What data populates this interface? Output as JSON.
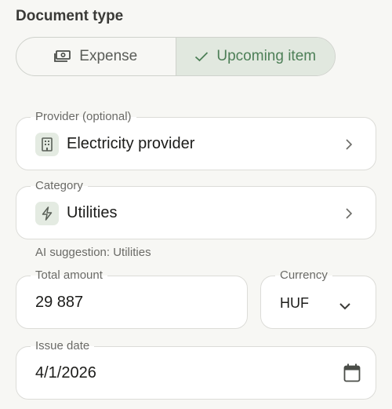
{
  "document_type": {
    "title": "Document type",
    "options": [
      {
        "label": "Expense",
        "icon": "money-icon",
        "selected": false
      },
      {
        "label": "Upcoming item",
        "icon": "check-icon",
        "selected": true
      }
    ]
  },
  "provider": {
    "label": "Provider (optional)",
    "value": "Electricity provider",
    "icon": "building-icon"
  },
  "category": {
    "label": "Category",
    "value": "Utilities",
    "icon": "lightning-icon"
  },
  "ai_suggestion": "AI suggestion: Utilities",
  "total_amount": {
    "label": "Total amount",
    "value": "29 887"
  },
  "currency": {
    "label": "Currency",
    "value": "HUF"
  },
  "issue_date": {
    "label": "Issue date",
    "value": "4/1/2026",
    "icon": "calendar-icon"
  },
  "colors": {
    "accent": "#4d7f57",
    "selected_bg": "#e1e8df",
    "icon_bg": "#e4ebe2",
    "background": "#f7f7f4"
  }
}
